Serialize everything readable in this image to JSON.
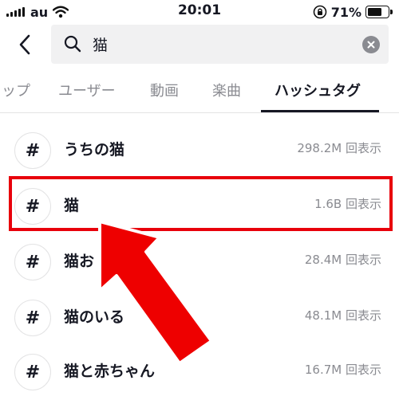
{
  "status_bar": {
    "carrier": "au",
    "time": "20:01",
    "battery": "71%",
    "battery_level": 0.71,
    "icons": [
      "signal-icon",
      "wifi-icon",
      "orientation-lock-icon",
      "battery-icon"
    ]
  },
  "search": {
    "query": "猫",
    "back_icon": "chevron-left-icon",
    "search_icon": "search-icon",
    "clear_icon": "clear-icon"
  },
  "tabs": [
    {
      "label": "ップ",
      "active": false
    },
    {
      "label": "ユーザー",
      "active": false
    },
    {
      "label": "動画",
      "active": false
    },
    {
      "label": "楽曲",
      "active": false
    },
    {
      "label": "ハッシュタグ",
      "active": true
    }
  ],
  "results": [
    {
      "icon": "#",
      "name": "うちの猫",
      "views": "298.2M 回表示"
    },
    {
      "icon": "#",
      "name": "猫",
      "views": "1.6B 回表示"
    },
    {
      "icon": "#",
      "name": "猫お",
      "views": "28.4M 回表示"
    },
    {
      "icon": "#",
      "name": "猫のいる",
      "views": "48.1M 回表示"
    },
    {
      "icon": "#",
      "name": "猫と赤ちゃん",
      "views": "16.7M 回表示"
    }
  ],
  "annotation": {
    "highlight_color": "#e8000b",
    "highlighted_result": "猫",
    "arrow_color": "#ee0000"
  }
}
